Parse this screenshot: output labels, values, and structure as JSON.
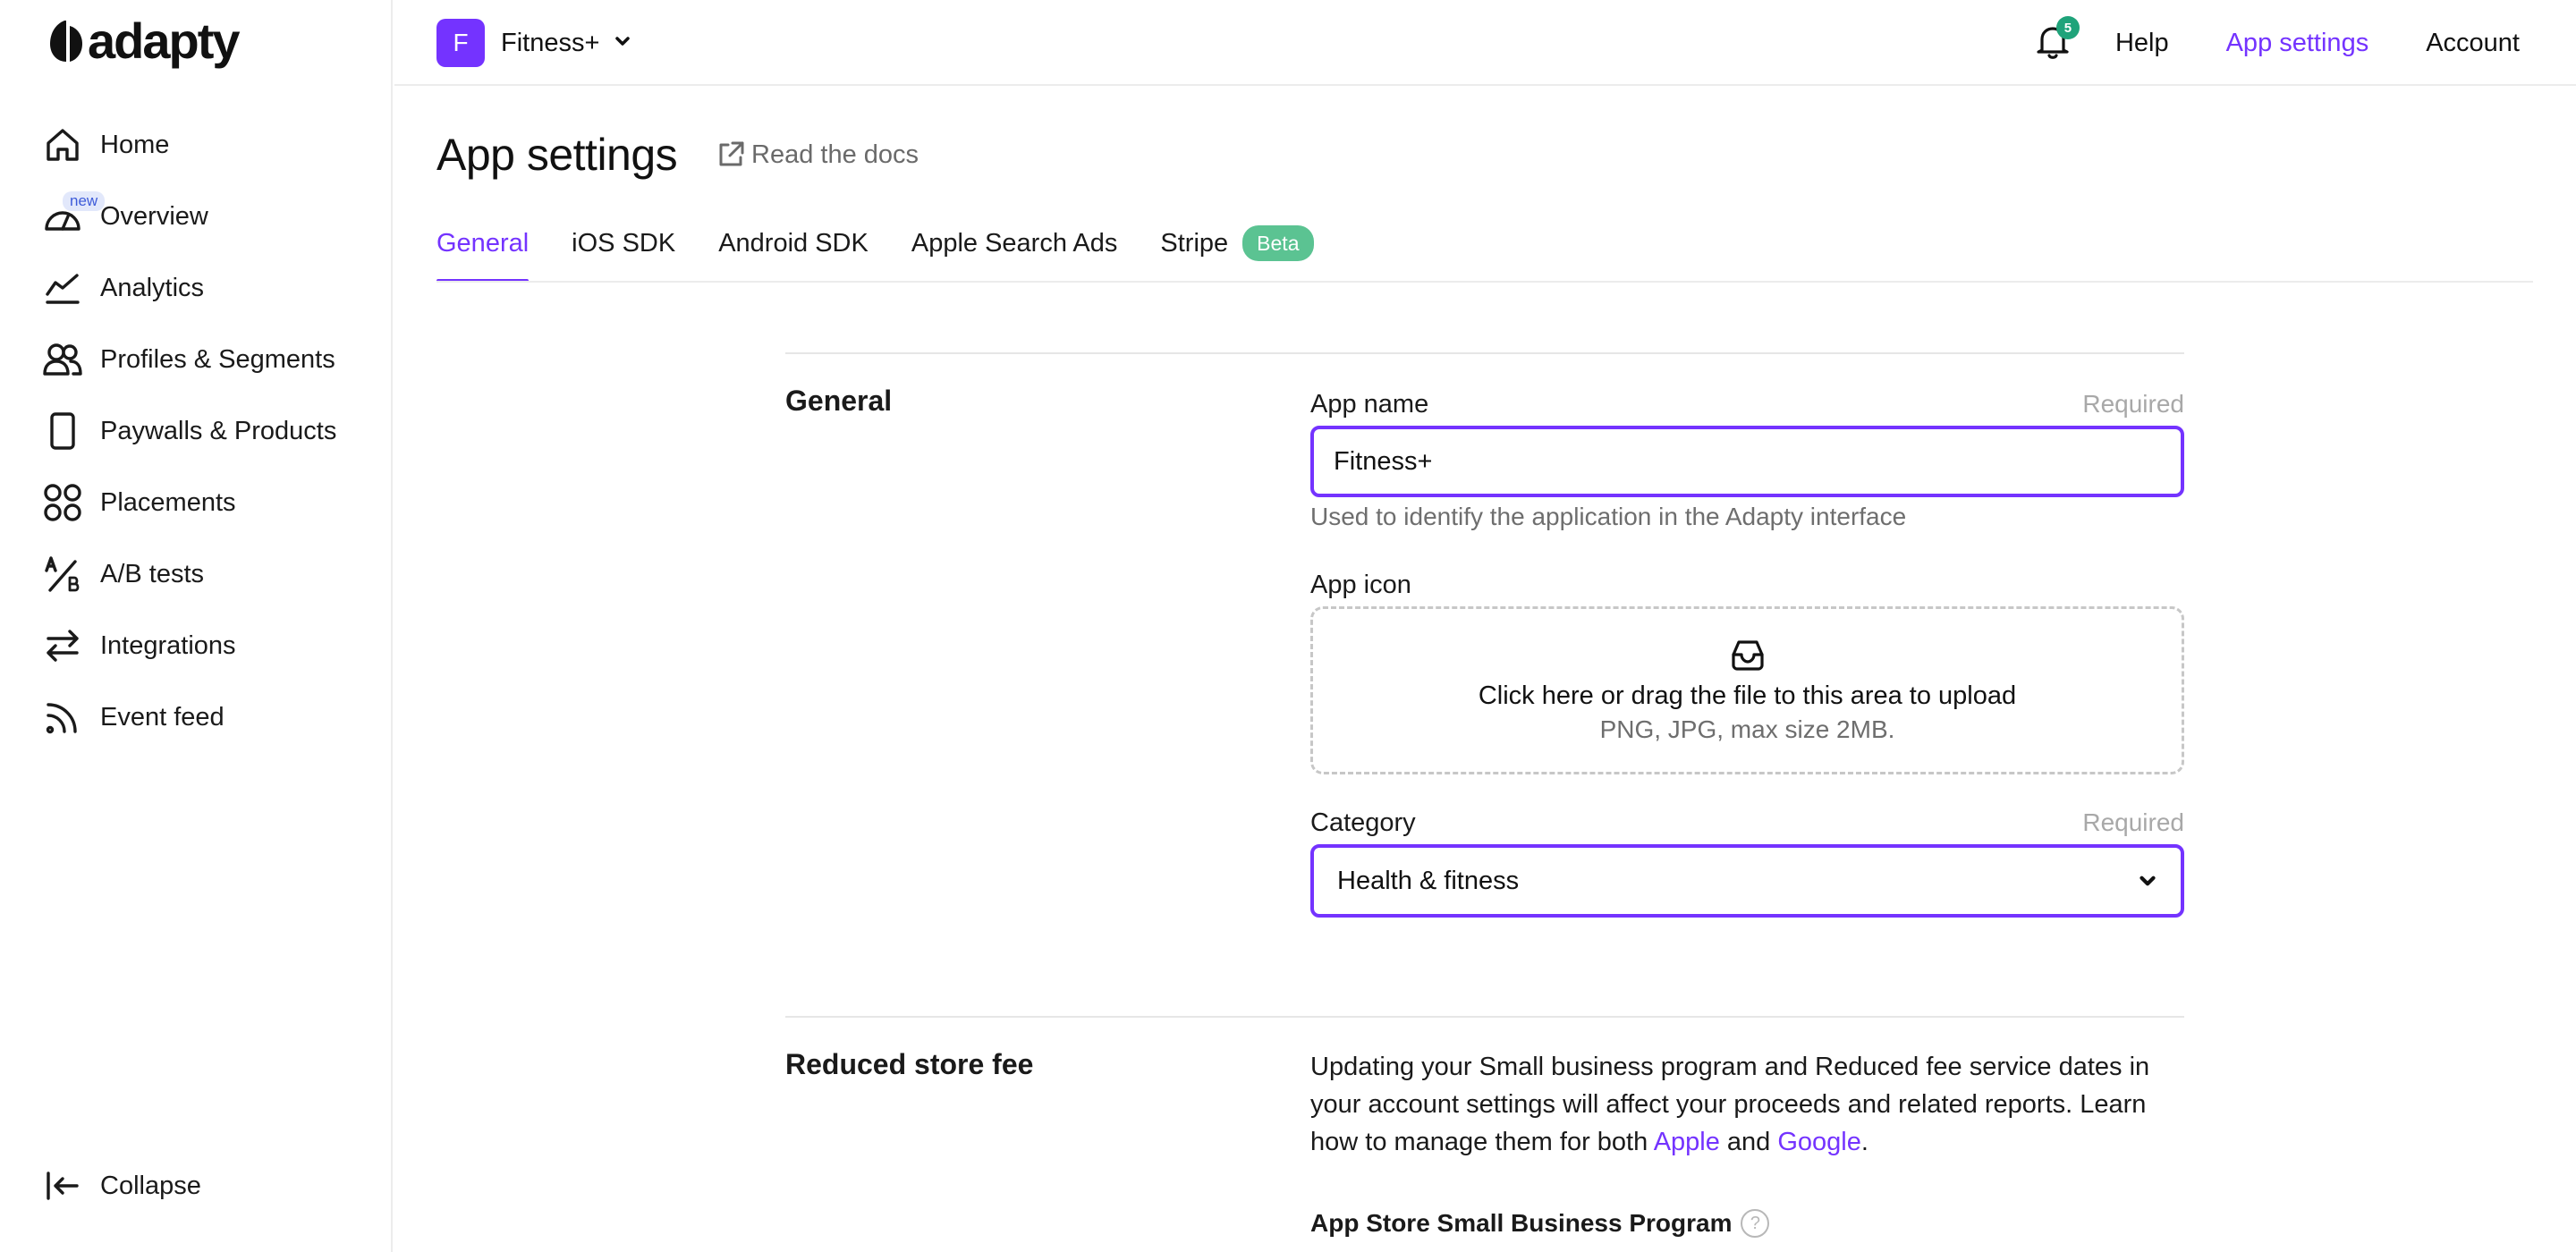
{
  "brand": {
    "logo_text": "adapty",
    "accent": "#7433ff"
  },
  "sidebar": {
    "items": [
      {
        "label": "Home",
        "icon": "home-icon"
      },
      {
        "label": "Overview",
        "icon": "gauge-icon",
        "badge": "new"
      },
      {
        "label": "Analytics",
        "icon": "chart-line-icon"
      },
      {
        "label": "Profiles & Segments",
        "icon": "users-icon"
      },
      {
        "label": "Paywalls & Products",
        "icon": "phone-icon"
      },
      {
        "label": "Placements",
        "icon": "grid-circles-icon"
      },
      {
        "label": "A/B tests",
        "icon": "ab-test-icon"
      },
      {
        "label": "Integrations",
        "icon": "swap-arrows-icon"
      },
      {
        "label": "Event feed",
        "icon": "rss-icon"
      }
    ],
    "collapse_label": "Collapse"
  },
  "topbar": {
    "app_initial": "F",
    "app_name": "Fitness+",
    "notification_count": "5",
    "links": {
      "help": "Help",
      "app_settings": "App settings",
      "account": "Account"
    }
  },
  "page": {
    "title": "App settings",
    "docs_link": "Read the docs",
    "tabs": [
      {
        "label": "General",
        "active": true
      },
      {
        "label": "iOS SDK"
      },
      {
        "label": "Android SDK"
      },
      {
        "label": "Apple Search Ads"
      },
      {
        "label": "Stripe",
        "badge": "Beta"
      }
    ]
  },
  "general": {
    "section_title": "General",
    "app_name": {
      "label": "App name",
      "required": "Required",
      "value": "Fitness+",
      "hint": "Used to identify the application in the Adapty interface"
    },
    "app_icon": {
      "label": "App icon",
      "upload_text": "Click here or drag the file to this area to upload",
      "upload_hint": "PNG, JPG, max size 2MB."
    },
    "category": {
      "label": "Category",
      "required": "Required",
      "value": "Health & fitness"
    }
  },
  "reduced_fee": {
    "section_title": "Reduced store fee",
    "text_before": "Updating your Small business program and Reduced fee service dates in your account settings will affect your proceeds and related reports. Learn how to manage them for both ",
    "link_apple": "Apple",
    "text_and": " and ",
    "link_google": "Google",
    "text_end": ".",
    "program_label": "App Store Small Business Program",
    "help_glyph": "?"
  }
}
